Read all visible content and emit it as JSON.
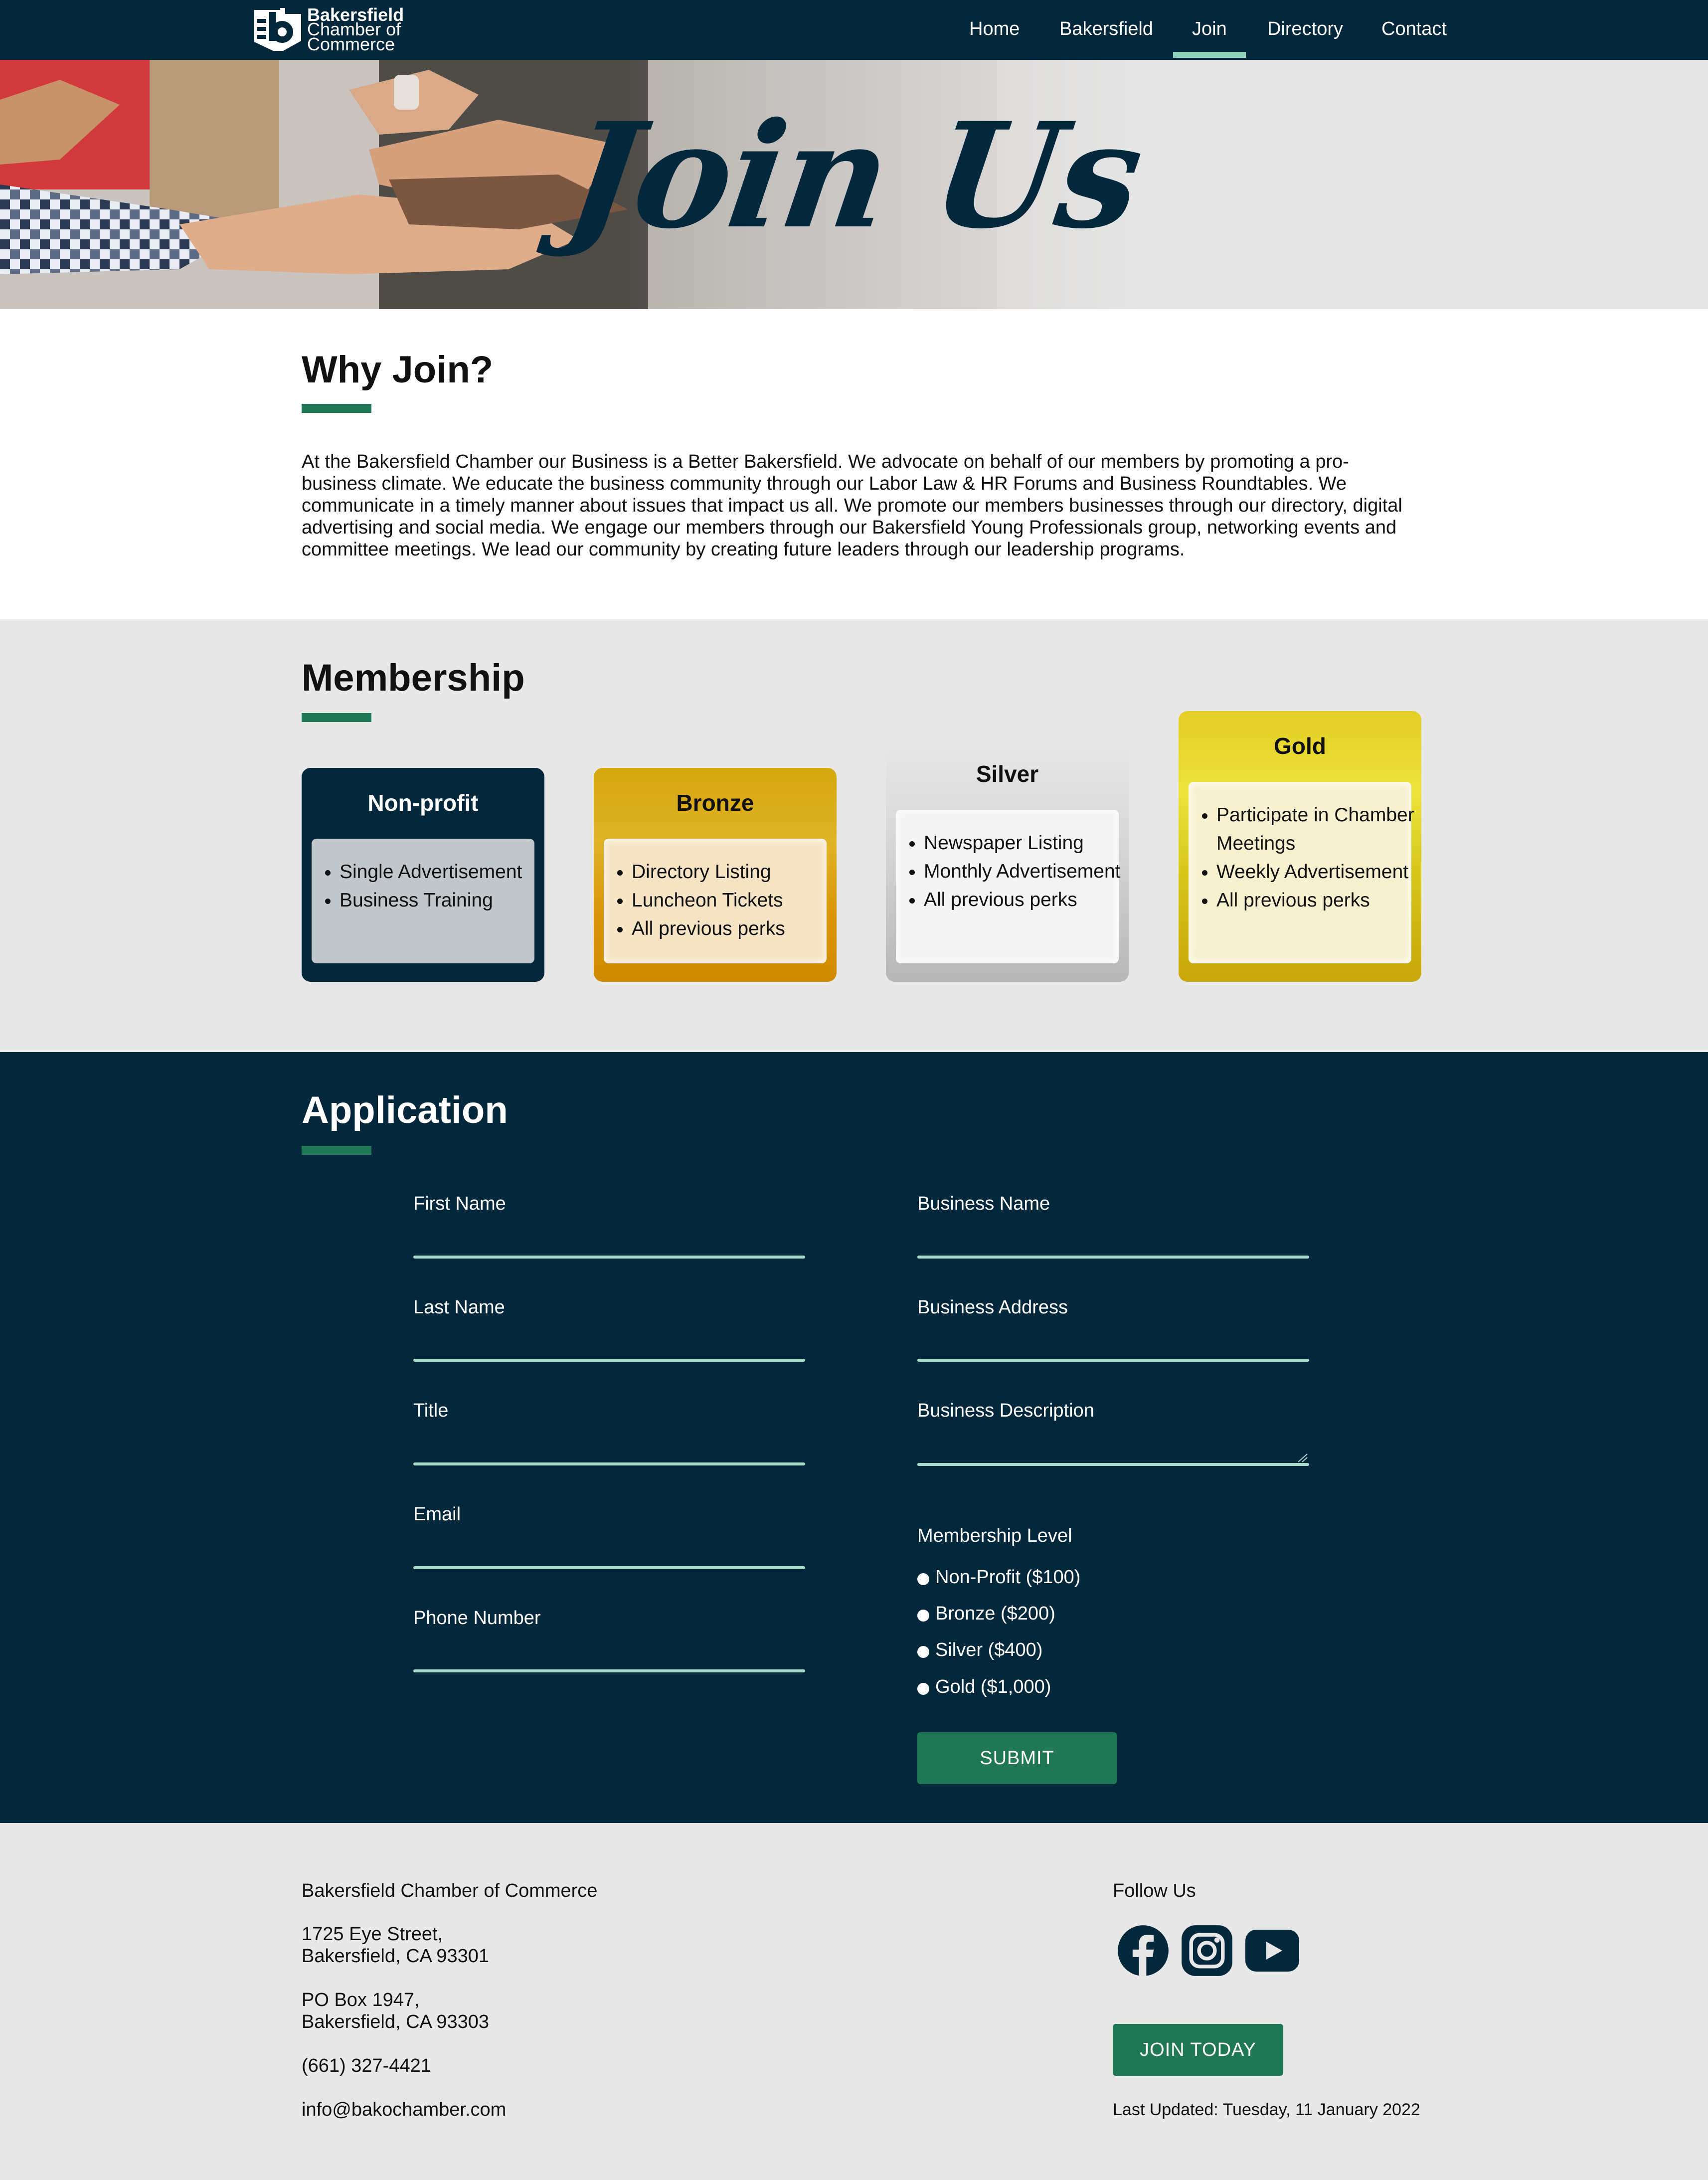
{
  "nav": {
    "logo_line1": "Bakersfield",
    "logo_line2": "Chamber of",
    "logo_line3": "Commerce",
    "items": [
      "Home",
      "Bakersfield",
      "Join",
      "Directory",
      "Contact"
    ],
    "active": "Join"
  },
  "hero": {
    "title": "Join Us"
  },
  "why": {
    "heading": "Why Join?",
    "text": "At the Bakersfield Chamber our Business is a Better Bakersfield. We advocate on behalf of our members by promoting a pro-business climate. We educate the business community through our Labor Law & HR Forums and Business Roundtables. We communicate in a timely manner about issues that impact us all. We promote our members businesses through our directory, digital advertising and social media. We engage our members through our Bakersfield Young Professionals group, networking events and committee meetings. We lead our community by creating future leaders through our leadership programs."
  },
  "membership": {
    "heading": "Membership",
    "tiers": [
      {
        "name": "Non-profit",
        "perks": [
          "Single Advertisement",
          "Business Training"
        ]
      },
      {
        "name": "Bronze",
        "perks": [
          "Directory Listing",
          "Luncheon Tickets",
          "All previous perks"
        ]
      },
      {
        "name": "Silver",
        "perks": [
          "Newspaper Listing",
          "Monthly Advertisement",
          "All previous perks"
        ]
      },
      {
        "name": "Gold",
        "perks": [
          "Participate in Chamber Meetings",
          "Weekly Advertisement",
          "All previous perks"
        ]
      }
    ]
  },
  "application": {
    "heading": "Application",
    "fields": {
      "first_name": "First Name",
      "last_name": "Last Name",
      "title": "Title",
      "email": "Email",
      "phone": "Phone Number",
      "business_name": "Business Name",
      "business_address": "Business Address",
      "business_description": "Business Description"
    },
    "membership_label": "Membership Level",
    "levels": [
      "Non-Profit ($100)",
      "Bronze ($200)",
      "Silver ($400)",
      "Gold ($1,000)"
    ],
    "submit": "SUBMIT"
  },
  "footer": {
    "org": "Bakersfield Chamber of Commerce",
    "addr1_line1": "1725 Eye Street,",
    "addr1_line2": "Bakersfield, CA 93301",
    "addr2_line1": "PO Box 1947,",
    "addr2_line2": "Bakersfield, CA 93303",
    "phone": "(661) 327-4421",
    "email": "info@bakochamber.com",
    "follow": "Follow Us",
    "social_icons": [
      "facebook-icon",
      "instagram-icon",
      "youtube-icon"
    ],
    "join_button": "JOIN TODAY",
    "updated": "Last Updated: Tuesday, 11 January 2022"
  },
  "colors": {
    "navy": "#03283b",
    "green": "#1f7756",
    "mint": "#a7dccb",
    "light_grey": "#e8e8e8"
  }
}
